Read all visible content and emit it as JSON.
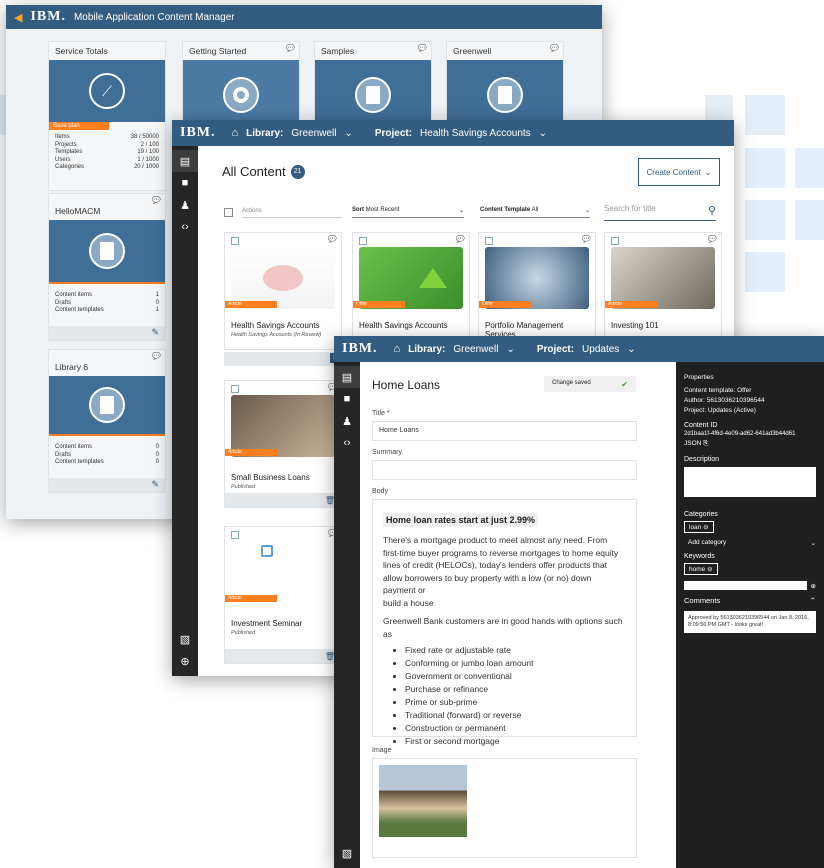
{
  "colors": {
    "brand": "#325c80",
    "accent": "#ff7f1e",
    "sidebar": "#262626"
  },
  "back": {
    "app_title": "Mobile Application Content Manager",
    "cards": [
      {
        "title": "Service Totals",
        "plan": "Base plan",
        "stats": [
          [
            "Items",
            "38 / 50000"
          ],
          [
            "Projects",
            "2 / 100"
          ],
          [
            "Templates",
            "19 / 100"
          ],
          [
            "Users",
            "1 / 1000"
          ],
          [
            "Categories",
            "20 / 1000"
          ]
        ]
      },
      {
        "title": "Getting Started"
      },
      {
        "title": "Samples"
      },
      {
        "title": "Greenwell"
      },
      {
        "title": "HelloMACM",
        "stats": [
          [
            "Content items",
            "1"
          ],
          [
            "Drafts",
            "0"
          ],
          [
            "Content templates",
            "1"
          ]
        ]
      },
      {
        "title": "Library 6",
        "stats": [
          [
            "Content items",
            "0"
          ],
          [
            "Drafts",
            "0"
          ],
          [
            "Content templates",
            "0"
          ]
        ]
      }
    ]
  },
  "mid": {
    "library_label": "Library:",
    "library": "Greenwell",
    "project_label": "Project:",
    "project": "Health Savings Accounts",
    "heading": "All Content",
    "count": "21",
    "create_button": "Create Content",
    "actions": "Actions",
    "sort_label": "Sort",
    "sort_value": "Most Recent",
    "template_label": "Content Template",
    "template_value": "All",
    "search_placeholder": "Search for title",
    "tiles": [
      {
        "tag": "Article",
        "title": "Health Savings Accounts",
        "sub": "Health Savings Accounts (In Review)"
      },
      {
        "tag": "Offer",
        "title": "Health Savings Accounts",
        "sub": ""
      },
      {
        "tag": "Offer",
        "title": "Portfolio Management Services",
        "sub": ""
      },
      {
        "tag": "Article",
        "title": "Investing 101",
        "sub": ""
      },
      {
        "tag": "Article",
        "title": "Small Business Loans",
        "sub": "Published"
      },
      {
        "tag": "Article",
        "title": "Investment Seminar",
        "sub": "Published"
      }
    ]
  },
  "front": {
    "library_label": "Library:",
    "library": "Greenwell",
    "project_label": "Project:",
    "project": "Updates",
    "heading": "Home Loans",
    "saved": "Change saved",
    "title_label": "Title *",
    "title_value": "Home Loans",
    "summary_label": "Summary",
    "body_label": "Body",
    "body_heading": "Home loan rates start at just 2.99%",
    "body_p1": "There's a mortgage product to meet almost any need. From first-time buyer programs to reverse mortgages to home equity lines of credit (HELOCs), today's lenders offer products that allow borrowers to buy property with a low (or no) down payment or",
    "body_p1b": "build a house",
    "body_p2": "Greenwell Bank customers are in good hands with options such as",
    "bullets": [
      "Fixed rate or adjustable rate",
      "Conforming or jumbo loan amount",
      "Government or conventional",
      "Purchase or refinance",
      "Prime or sub-prime",
      "Traditional (forward) or reverse",
      "Construction or permanent",
      "First or second mortgage"
    ],
    "image_label": "Image",
    "props": {
      "heading": "Properties",
      "template": "Content template: Offer",
      "author": "Author: 5613036210396544",
      "project": "Project: Updates (Active)",
      "id_label": "Content ID",
      "id": "2d1baa1f-4f6d-4e09-ad62-641ad3b44d61",
      "json": "JSON",
      "desc": "Description",
      "cat_label": "Categories",
      "cat": "loan",
      "add_cat": "Add category",
      "kw_label": "Keywords",
      "kw": "home",
      "comments": "Comments",
      "comment": "Approved by 5613036210396544 on Jan 8, 2016, 8:09:56 PM GMT - looks great!"
    }
  }
}
